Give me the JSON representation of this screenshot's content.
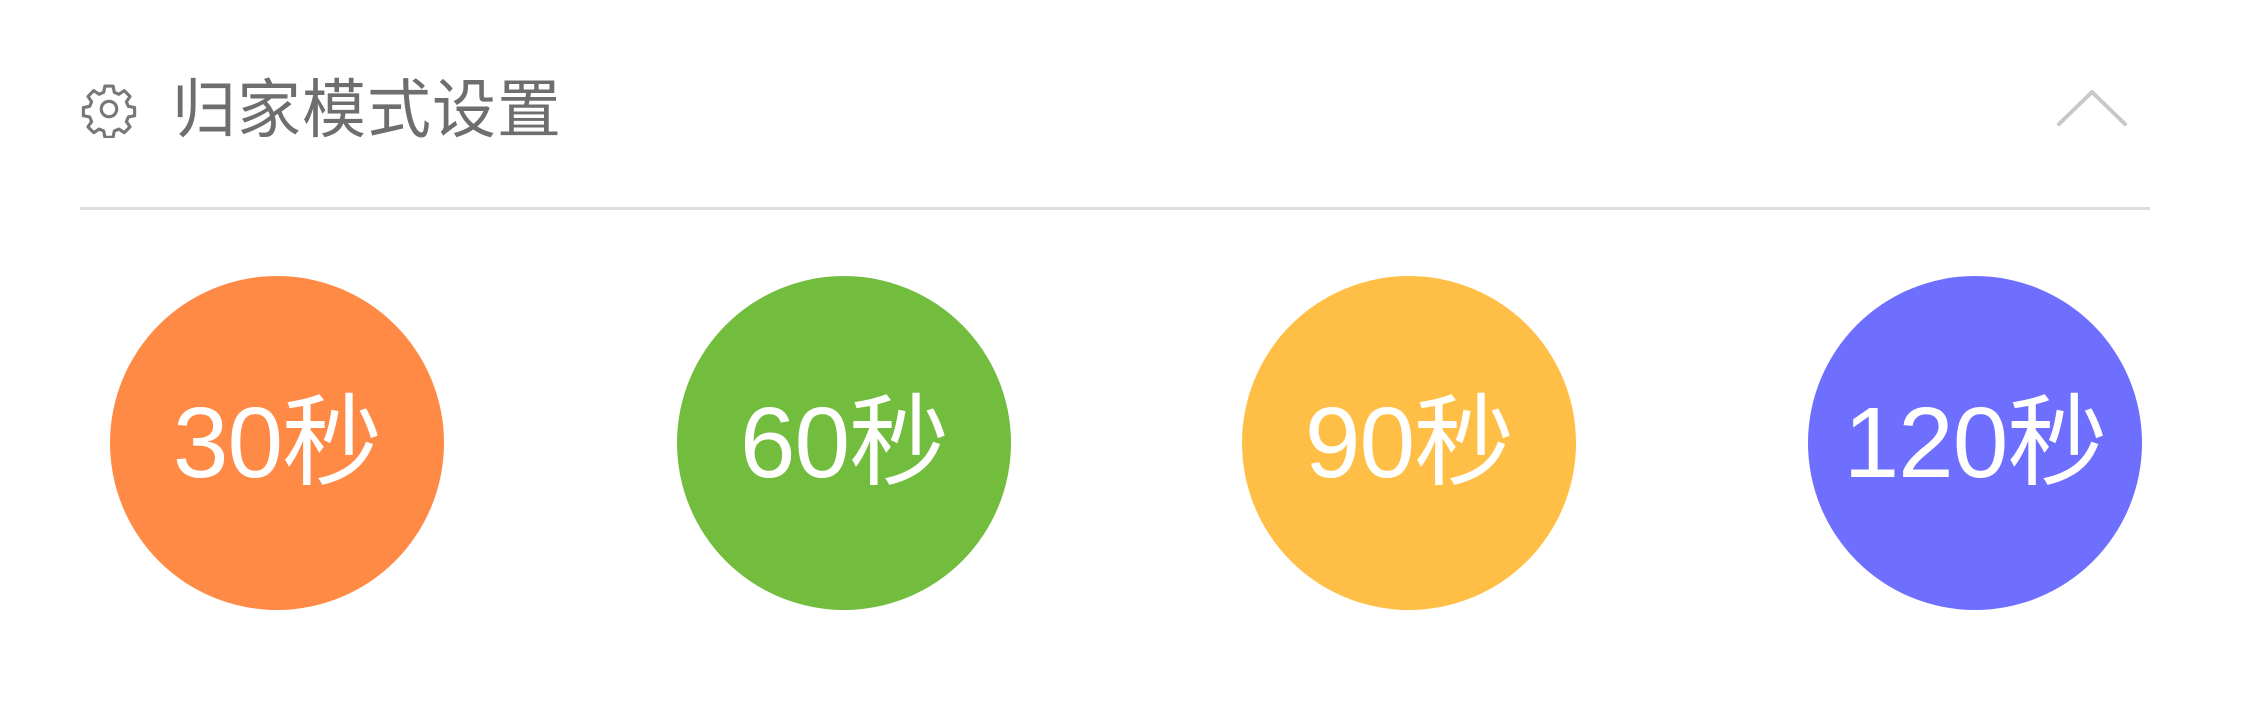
{
  "header": {
    "title": "归家模式设置",
    "icon": "gear-icon",
    "collapse_icon": "chevron-up-icon"
  },
  "options": [
    {
      "label": "30秒",
      "color": "#FF8A45"
    },
    {
      "label": "60秒",
      "color": "#73BD3E"
    },
    {
      "label": "90秒",
      "color": "#FFBF47"
    },
    {
      "label": "120秒",
      "color": "#6E6EFF"
    }
  ]
}
